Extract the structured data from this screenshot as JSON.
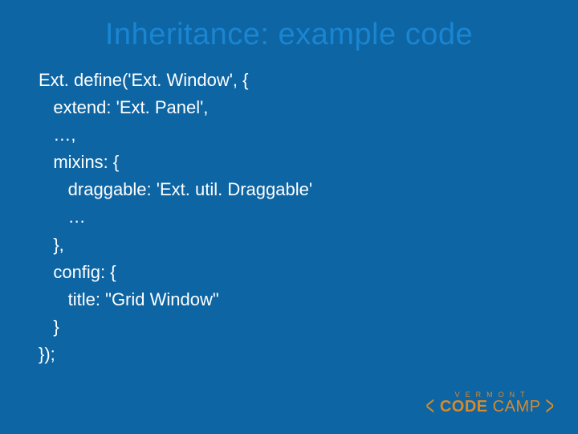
{
  "title": "Inheritance: example code",
  "code": {
    "l1": "Ext. define('Ext. Window', {",
    "l2": "   extend: 'Ext. Panel',",
    "l3": "   …,",
    "l4": "   mixins: {",
    "l5": "      draggable: 'Ext. util. Draggable'",
    "l6": "      …",
    "l7": "   },",
    "l8": "   config: {",
    "l9": "      title: \"Grid Window\"",
    "l10": "   }",
    "l11": "});"
  },
  "logo": {
    "top": "VERMONT",
    "bold": "CODE",
    "light": "CAMP",
    "left": "<",
    "right": ">"
  }
}
